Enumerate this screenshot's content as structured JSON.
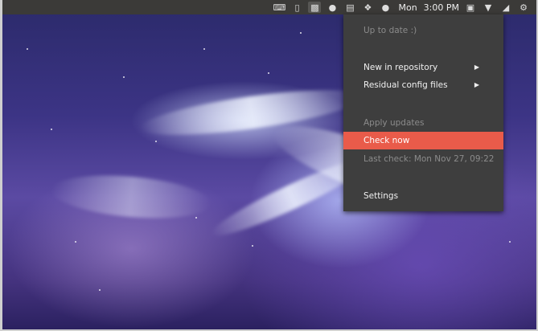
{
  "topbar": {
    "clock_day": "Mon",
    "clock_time": "3:00 PM",
    "icons": [
      "keyboard-icon",
      "phone-icon",
      "package-icon",
      "chat-icon",
      "clipboard-icon",
      "dropbox-icon",
      "status-dot-icon",
      "screen-icon",
      "wifi-icon",
      "volume-icon",
      "gear-icon"
    ]
  },
  "menu": {
    "status": "Up to date :)",
    "new_in_repository": "New in repository",
    "residual_config_files": "Residual config files",
    "apply_updates": "Apply updates",
    "check_now": "Check now",
    "last_check": "Last check: Mon Nov 27, 09:22",
    "settings": "Settings"
  },
  "colors": {
    "panel_bg": "#3b3a38",
    "menu_bg": "#3e3e3e",
    "accent": "#e95b4a"
  }
}
